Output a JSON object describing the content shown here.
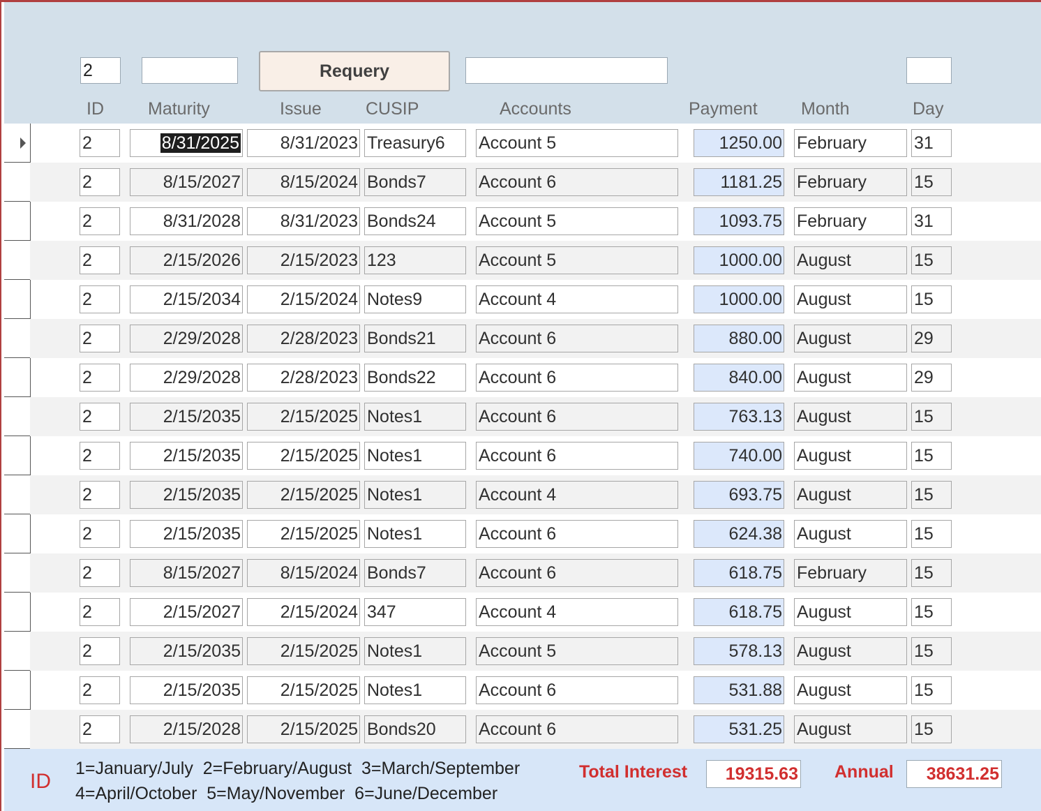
{
  "header": {
    "id_filter_value": "2",
    "filter2_value": "",
    "requery_label": "Requery",
    "filter3_value": "",
    "filter4_value": ""
  },
  "columns": {
    "id": "ID",
    "maturity": "Maturity",
    "issue": "Issue",
    "cusip": "CUSIP",
    "accounts": "Accounts",
    "payment": "Payment",
    "month": "Month",
    "day": "Day"
  },
  "rows": [
    {
      "id": "2",
      "maturity": "8/31/2025",
      "issue": "8/31/2023",
      "cusip": "Treasury6",
      "account": "Account 5",
      "payment": "1250.00",
      "month": "February",
      "day": "31"
    },
    {
      "id": "2",
      "maturity": "8/15/2027",
      "issue": "8/15/2024",
      "cusip": "Bonds7",
      "account": "Account 6",
      "payment": "1181.25",
      "month": "February",
      "day": "15"
    },
    {
      "id": "2",
      "maturity": "8/31/2028",
      "issue": "8/31/2023",
      "cusip": "Bonds24",
      "account": "Account 5",
      "payment": "1093.75",
      "month": "February",
      "day": "31"
    },
    {
      "id": "2",
      "maturity": "2/15/2026",
      "issue": "2/15/2023",
      "cusip": "123",
      "account": "Account 5",
      "payment": "1000.00",
      "month": "August",
      "day": "15"
    },
    {
      "id": "2",
      "maturity": "2/15/2034",
      "issue": "2/15/2024",
      "cusip": "Notes9",
      "account": "Account 4",
      "payment": "1000.00",
      "month": "August",
      "day": "15"
    },
    {
      "id": "2",
      "maturity": "2/29/2028",
      "issue": "2/28/2023",
      "cusip": "Bonds21",
      "account": "Account 6",
      "payment": "880.00",
      "month": "August",
      "day": "29"
    },
    {
      "id": "2",
      "maturity": "2/29/2028",
      "issue": "2/28/2023",
      "cusip": "Bonds22",
      "account": "Account 6",
      "payment": "840.00",
      "month": "August",
      "day": "29"
    },
    {
      "id": "2",
      "maturity": "2/15/2035",
      "issue": "2/15/2025",
      "cusip": "Notes1",
      "account": "Account 6",
      "payment": "763.13",
      "month": "August",
      "day": "15"
    },
    {
      "id": "2",
      "maturity": "2/15/2035",
      "issue": "2/15/2025",
      "cusip": "Notes1",
      "account": "Account 6",
      "payment": "740.00",
      "month": "August",
      "day": "15"
    },
    {
      "id": "2",
      "maturity": "2/15/2035",
      "issue": "2/15/2025",
      "cusip": "Notes1",
      "account": "Account 4",
      "payment": "693.75",
      "month": "August",
      "day": "15"
    },
    {
      "id": "2",
      "maturity": "2/15/2035",
      "issue": "2/15/2025",
      "cusip": "Notes1",
      "account": "Account 6",
      "payment": "624.38",
      "month": "August",
      "day": "15"
    },
    {
      "id": "2",
      "maturity": "8/15/2027",
      "issue": "8/15/2024",
      "cusip": "Bonds7",
      "account": "Account 6",
      "payment": "618.75",
      "month": "February",
      "day": "15"
    },
    {
      "id": "2",
      "maturity": "2/15/2027",
      "issue": "2/15/2024",
      "cusip": "347",
      "account": "Account 4",
      "payment": "618.75",
      "month": "August",
      "day": "15"
    },
    {
      "id": "2",
      "maturity": "2/15/2035",
      "issue": "2/15/2025",
      "cusip": "Notes1",
      "account": "Account 5",
      "payment": "578.13",
      "month": "August",
      "day": "15"
    },
    {
      "id": "2",
      "maturity": "2/15/2035",
      "issue": "2/15/2025",
      "cusip": "Notes1",
      "account": "Account 6",
      "payment": "531.88",
      "month": "August",
      "day": "15"
    },
    {
      "id": "2",
      "maturity": "2/15/2028",
      "issue": "2/15/2025",
      "cusip": "Bonds20",
      "account": "Account 6",
      "payment": "531.25",
      "month": "August",
      "day": "15"
    }
  ],
  "footer": {
    "id_label": "ID",
    "legend_line1": "1=January/July  2=February/August  3=March/September",
    "legend_line2": "4=April/October  5=May/November  6=June/December",
    "total_interest_label": "Total Interest",
    "total_interest_value": "19315.63",
    "annual_label": "Annual",
    "annual_value": "38631.25"
  },
  "colors": {
    "header_bg": "#d3e0ea",
    "footer_bg": "#d7e6f8",
    "payment_bg": "#dce8fb",
    "accent_red": "#d12f2f",
    "alt_row_bg": "#f2f2f2"
  }
}
